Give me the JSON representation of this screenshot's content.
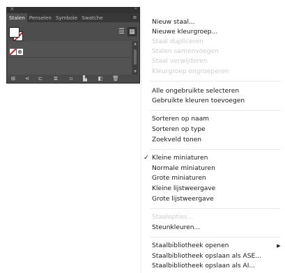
{
  "panel": {
    "close_glyph": "×",
    "collapse_glyph": "«",
    "tabs": [
      {
        "label": "Stalen",
        "active": true
      },
      {
        "label": "Penselen",
        "active": false
      },
      {
        "label": "Symbole",
        "active": false
      },
      {
        "label": "Swatche",
        "active": false
      }
    ],
    "tab_menu_glyph": "≡",
    "view_buttons": {
      "list_glyph": "☰",
      "grid_glyph": "▦",
      "selected": "grid"
    },
    "registration_glyph": "⊕",
    "bottom_icons": [
      {
        "name": "swatch-libraries-menu-icon",
        "glyph": "⊞"
      },
      {
        "name": "show-swatch-kinds-icon",
        "glyph": "⋖"
      },
      {
        "name": "place-swatches-icon",
        "glyph": "⊏"
      },
      {
        "name": "swatch-options-icon",
        "glyph": "≣"
      },
      {
        "name": "color-group-icon",
        "glyph": "▫"
      },
      {
        "name": "new-color-group-icon",
        "glyph": "▙"
      },
      {
        "name": "new-swatch-icon",
        "glyph": "◧"
      },
      {
        "name": "delete-swatch-icon",
        "glyph": "🗑"
      }
    ]
  },
  "menu": {
    "items": [
      {
        "label": "Nieuw staal...",
        "enabled": true
      },
      {
        "label": "Nieuwe kleurgroep...",
        "enabled": true
      },
      {
        "label": "Staal dupliceren",
        "enabled": false
      },
      {
        "label": "Stalen samenvoegen",
        "enabled": false
      },
      {
        "label": "Staal verwijderen",
        "enabled": false
      },
      {
        "label": "Kleurgroep ongroeperen",
        "enabled": false
      },
      {
        "label": "Alle ongebruikte selecteren",
        "enabled": true
      },
      {
        "label": "Gebruikte kleuren toevoegen",
        "enabled": true
      },
      {
        "label": "Sorteren op naam",
        "enabled": true
      },
      {
        "label": "Sorteren op type",
        "enabled": true
      },
      {
        "label": "Zoekveld tonen",
        "enabled": true
      },
      {
        "label": "Kleine miniaturen",
        "enabled": true,
        "checked": true
      },
      {
        "label": "Normale miniaturen",
        "enabled": true
      },
      {
        "label": "Grote miniaturen",
        "enabled": true
      },
      {
        "label": "Kleine lijstweergave",
        "enabled": true
      },
      {
        "label": "Grote lijstweergave",
        "enabled": true
      },
      {
        "label": "Staalopties...",
        "enabled": false
      },
      {
        "label": "Steunkleuren...",
        "enabled": true
      },
      {
        "label": "Staalbibliotheek openen",
        "enabled": true,
        "submenu": true
      },
      {
        "label": "Staalbibliotheek opslaan als ASE...",
        "enabled": true
      },
      {
        "label": "Staalbibliotheek opslaan als AI...",
        "enabled": true
      }
    ],
    "check_glyph": "✓",
    "submenu_glyph": "▶"
  }
}
